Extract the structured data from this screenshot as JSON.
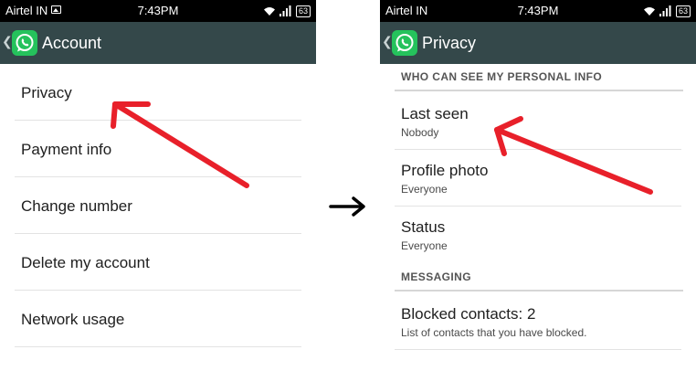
{
  "left_screen": {
    "status_bar": {
      "carrier": "Airtel IN",
      "time": "7:43PM",
      "battery": "63"
    },
    "action_bar": {
      "back_icon": "chevron-left-icon",
      "logo_icon": "whatsapp-logo-icon",
      "title": "Account"
    },
    "menu_items": [
      {
        "label": "Privacy"
      },
      {
        "label": "Payment info"
      },
      {
        "label": "Change number"
      },
      {
        "label": "Delete my account"
      },
      {
        "label": "Network usage"
      }
    ]
  },
  "right_screen": {
    "status_bar": {
      "carrier": "Airtel IN",
      "time": "7:43PM",
      "battery": "63"
    },
    "action_bar": {
      "back_icon": "chevron-left-icon",
      "logo_icon": "whatsapp-logo-icon",
      "title": "Privacy"
    },
    "sections": [
      {
        "header": "WHO CAN SEE MY PERSONAL INFO",
        "rows": [
          {
            "title": "Last seen",
            "summary": "Nobody"
          },
          {
            "title": "Profile photo",
            "summary": "Everyone"
          },
          {
            "title": "Status",
            "summary": "Everyone"
          }
        ]
      },
      {
        "header": "MESSAGING",
        "rows": [
          {
            "title": "Blocked contacts: 2",
            "summary": "List of contacts that you have blocked."
          }
        ]
      }
    ]
  },
  "annotations": {
    "arrow_color": "#e8202a",
    "flow_arrow_color": "#000000"
  },
  "theme": {
    "action_bar_bg": "#34484a",
    "whatsapp_green": "#25c25c",
    "status_bar_bg": "#000000"
  }
}
